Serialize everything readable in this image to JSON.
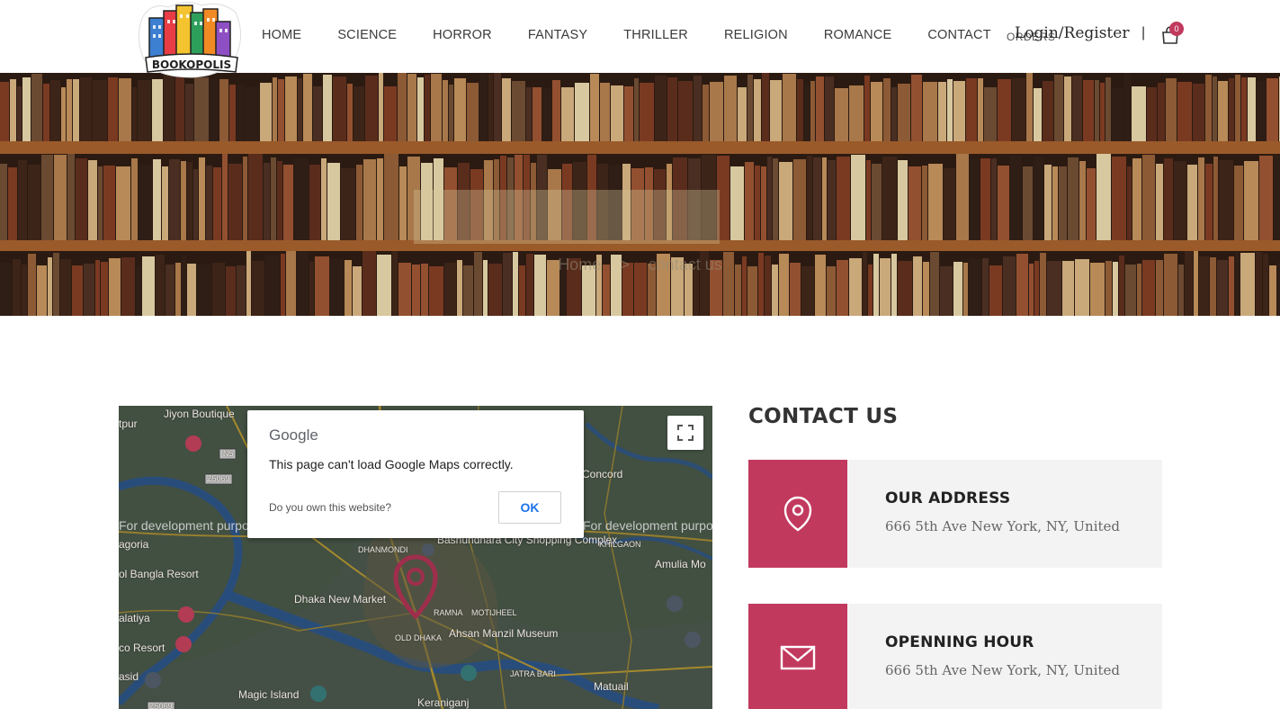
{
  "header": {
    "logo_text": "BOOKOPOLIS",
    "nav": [
      {
        "label": "HOME",
        "name": "nav-home"
      },
      {
        "label": "SCIENCE",
        "name": "nav-science"
      },
      {
        "label": "HORROR",
        "name": "nav-horror"
      },
      {
        "label": "FANTASY",
        "name": "nav-fantasy"
      },
      {
        "label": "THRILLER",
        "name": "nav-thriller"
      },
      {
        "label": "RELIGION",
        "name": "nav-religion"
      },
      {
        "label": "ROMANCE",
        "name": "nav-romance"
      },
      {
        "label": "CONTACT",
        "name": "nav-contact"
      }
    ],
    "orders_label": "ORDERS",
    "login_label": "Login/Register",
    "separator": "|",
    "cart_count": "0"
  },
  "hero": {
    "breadcrumb_home": "Home",
    "breadcrumb_sep": ">",
    "breadcrumb_current": "contact us"
  },
  "map": {
    "dialog": {
      "brand": "Google",
      "message": "This page can't load Google Maps correctly.",
      "question": "Do you own this website?",
      "ok_label": "OK"
    },
    "dev_text": "For development purposes only",
    "labels": [
      "Jiyon Boutique",
      "tpur",
      "N5",
      "Z5069",
      "Concord",
      "agoria",
      "Bashundhara City Shopping Complex",
      "KHILGAON",
      "Amulia Mo",
      "ol Bangla Resort",
      "DHANMONDI",
      "Dhaka New Market",
      "alatiya",
      "RAMNA",
      "MOTIJHEEL",
      "OLD DHAKA",
      "Ahsan Manzil Museum",
      "co Resort",
      "asid",
      "JATRA BARI",
      "Matuail",
      "Magic Island",
      "Keraniganj",
      "Z5069"
    ]
  },
  "contact": {
    "title": "CONTACT US",
    "cards": [
      {
        "title": "OUR ADDRESS",
        "text": "666 5th Ave New York, NY, United",
        "icon": "map-pin-icon"
      },
      {
        "title": "OPENNING HOUR",
        "text": "666 5th Ave New York, NY, United",
        "icon": "envelope-icon"
      }
    ]
  },
  "colors": {
    "accent": "#c2395e",
    "card_bg": "#f3f3f3",
    "text_dark": "#333333"
  }
}
